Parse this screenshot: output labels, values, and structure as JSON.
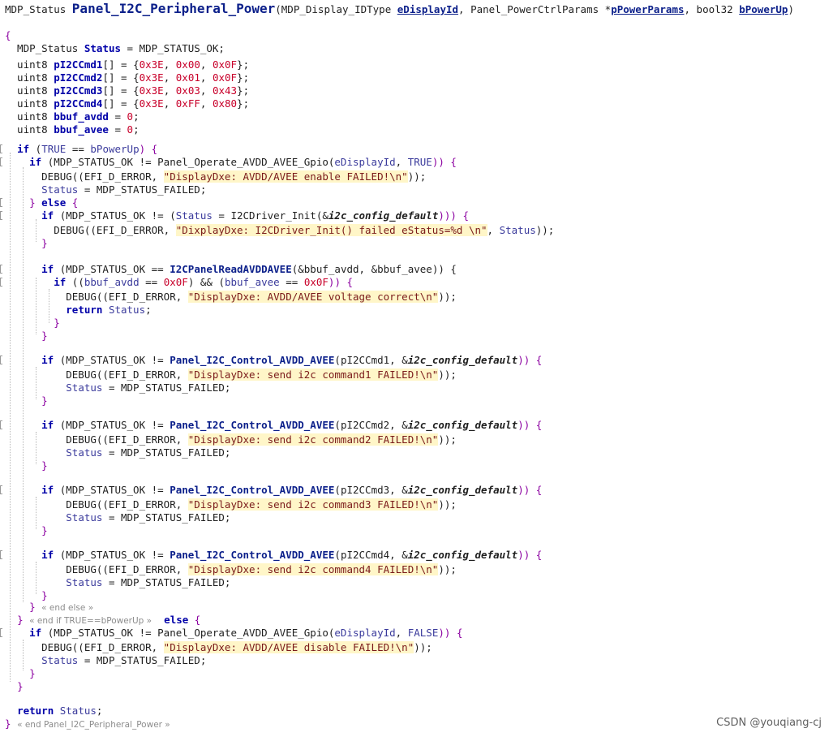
{
  "window": {
    "title": "Panel_I2C_Peripheral_Power"
  },
  "watermark": "CSDN @youqiang-cj",
  "lines": [
    {
      "t": [
        [
          "MDP_Status ",
          "typ"
        ],
        [
          "Panel_I2C_Peripheral_Power",
          "fnbig"
        ],
        [
          "(MDP_Display_IDType ",
          "typ"
        ],
        [
          "eDisplayId",
          "prm"
        ],
        [
          ", Panel_PowerCtrlParams *",
          "typ"
        ],
        [
          "pPowerParams",
          "prm"
        ],
        [
          ", bool32 ",
          "typ"
        ],
        [
          "bPowerUp",
          "prm"
        ],
        [
          ")",
          "typ"
        ]
      ]
    },
    {
      "t": [
        [
          "{",
          "brc"
        ]
      ]
    },
    {
      "t": [
        [
          "  MDP_Status ",
          "typ"
        ],
        [
          "Status",
          "kw"
        ],
        [
          " = MDP_STATUS_OK;",
          "cst"
        ]
      ]
    },
    {
      "t": []
    },
    {
      "t": [
        [
          "  uint8 ",
          "typ"
        ],
        [
          "pI2CCmd1",
          "kw"
        ],
        [
          "[] = {",
          "typ"
        ],
        [
          "0x3E",
          "num"
        ],
        [
          ", ",
          "typ"
        ],
        [
          "0x00",
          "num"
        ],
        [
          ", ",
          "typ"
        ],
        [
          "0x0F",
          "num"
        ],
        [
          "};",
          "typ"
        ]
      ]
    },
    {
      "t": [
        [
          "  uint8 ",
          "typ"
        ],
        [
          "pI2CCmd2",
          "kw"
        ],
        [
          "[] = {",
          "typ"
        ],
        [
          "0x3E",
          "num"
        ],
        [
          ", ",
          "typ"
        ],
        [
          "0x01",
          "num"
        ],
        [
          ", ",
          "typ"
        ],
        [
          "0x0F",
          "num"
        ],
        [
          "};",
          "typ"
        ]
      ]
    },
    {
      "t": [
        [
          "  uint8 ",
          "typ"
        ],
        [
          "pI2CCmd3",
          "kw"
        ],
        [
          "[] = {",
          "typ"
        ],
        [
          "0x3E",
          "num"
        ],
        [
          ", ",
          "typ"
        ],
        [
          "0x03",
          "num"
        ],
        [
          ", ",
          "typ"
        ],
        [
          "0x43",
          "num"
        ],
        [
          "};",
          "typ"
        ]
      ]
    },
    {
      "t": [
        [
          "  uint8 ",
          "typ"
        ],
        [
          "pI2CCmd4",
          "kw"
        ],
        [
          "[] = {",
          "typ"
        ],
        [
          "0x3E",
          "num"
        ],
        [
          ", ",
          "typ"
        ],
        [
          "0xFF",
          "num"
        ],
        [
          ", ",
          "typ"
        ],
        [
          "0x80",
          "num"
        ],
        [
          "};",
          "typ"
        ]
      ]
    },
    {
      "t": [
        [
          "  uint8 ",
          "typ"
        ],
        [
          "bbuf_avdd",
          "kw"
        ],
        [
          " = ",
          "typ"
        ],
        [
          "0",
          "num"
        ],
        [
          ";",
          "typ"
        ]
      ]
    },
    {
      "t": [
        [
          "  uint8 ",
          "typ"
        ],
        [
          "bbuf_avee",
          "kw"
        ],
        [
          " = ",
          "typ"
        ],
        [
          "0",
          "num"
        ],
        [
          ";",
          "typ"
        ]
      ]
    },
    {
      "t": []
    },
    {
      "m": 1,
      "t": [
        [
          "  ",
          "typ"
        ],
        [
          "if",
          "kw"
        ],
        [
          " (",
          "typ"
        ],
        [
          "TRUE",
          "var"
        ],
        [
          " == ",
          "typ"
        ],
        [
          "bPowerUp",
          "var"
        ],
        [
          ") {",
          "brc"
        ]
      ]
    },
    {
      "m": 1,
      "t": [
        [
          "    ",
          "typ"
        ],
        [
          "if",
          "kw"
        ],
        [
          " (MDP_STATUS_OK != Panel_Operate_AVDD_AVEE_Gpio(",
          "typ"
        ],
        [
          "eDisplayId",
          "var"
        ],
        [
          ", ",
          "typ"
        ],
        [
          "TRUE",
          "var"
        ],
        [
          ")) {",
          "brc"
        ]
      ]
    },
    {
      "t": [
        [
          "      DEBUG((EFI_D_ERROR, ",
          "typ"
        ],
        [
          "\"DisplayDxe: AVDD/AVEE enable FAILED!\\n\"",
          "str"
        ],
        [
          "));",
          "typ"
        ]
      ]
    },
    {
      "t": [
        [
          "      ",
          "typ"
        ],
        [
          "Status",
          "var"
        ],
        [
          " = MDP_STATUS_FAILED;",
          "cst"
        ]
      ]
    },
    {
      "m": 1,
      "t": [
        [
          "    ",
          "typ"
        ],
        [
          "}",
          "brc"
        ],
        [
          " ",
          "typ"
        ],
        [
          "else",
          "kw"
        ],
        [
          " {",
          "brc"
        ]
      ]
    },
    {
      "m": 1,
      "t": [
        [
          "      ",
          "typ"
        ],
        [
          "if",
          "kw"
        ],
        [
          " (MDP_STATUS_OK != (",
          "typ"
        ],
        [
          "Status",
          "var"
        ],
        [
          " = I2CDriver_Init(&",
          "typ"
        ],
        [
          "i2c_config_default",
          "ital"
        ],
        [
          "))) {",
          "brc"
        ]
      ]
    },
    {
      "t": [
        [
          "        DEBUG((EFI_D_ERROR, ",
          "typ"
        ],
        [
          "\"DixplayDxe: I2CDriver_Init() failed eStatus=%d \\n\"",
          "str"
        ],
        [
          ", ",
          "typ"
        ],
        [
          "Status",
          "var"
        ],
        [
          "));",
          "typ"
        ]
      ]
    },
    {
      "t": [
        [
          "      ",
          "typ"
        ],
        [
          "}",
          "brc"
        ]
      ]
    },
    {
      "t": []
    },
    {
      "m": 1,
      "t": [
        [
          "      ",
          "typ"
        ],
        [
          "if",
          "kw"
        ],
        [
          " (MDP_STATUS_OK == ",
          "typ"
        ],
        [
          "I2CPanelReadAVDDAVEE",
          "fnb"
        ],
        [
          "(&bbuf_avdd, &bbuf_avee)) {",
          "typ"
        ]
      ]
    },
    {
      "m": 1,
      "t": [
        [
          "        ",
          "typ"
        ],
        [
          "if",
          "kw"
        ],
        [
          " ((",
          "typ"
        ],
        [
          "bbuf_avdd",
          "var"
        ],
        [
          " == ",
          "typ"
        ],
        [
          "0x0F",
          "num"
        ],
        [
          ") && (",
          "typ"
        ],
        [
          "bbuf_avee",
          "var"
        ],
        [
          " == ",
          "typ"
        ],
        [
          "0x0F",
          "num"
        ],
        [
          ")) {",
          "brc"
        ]
      ]
    },
    {
      "t": [
        [
          "          DEBUG((EFI_D_ERROR, ",
          "typ"
        ],
        [
          "\"DisplayDxe: AVDD/AVEE voltage correct\\n\"",
          "str"
        ],
        [
          "));",
          "typ"
        ]
      ]
    },
    {
      "t": [
        [
          "          ",
          "typ"
        ],
        [
          "return",
          "kw"
        ],
        [
          " ",
          "typ"
        ],
        [
          "Status",
          "var"
        ],
        [
          ";",
          "typ"
        ]
      ]
    },
    {
      "t": [
        [
          "        ",
          "typ"
        ],
        [
          "}",
          "brc"
        ]
      ]
    },
    {
      "t": [
        [
          "      ",
          "typ"
        ],
        [
          "}",
          "brc"
        ]
      ]
    },
    {
      "t": []
    },
    {
      "m": 1,
      "t": [
        [
          "      ",
          "typ"
        ],
        [
          "if",
          "kw"
        ],
        [
          " (MDP_STATUS_OK != ",
          "typ"
        ],
        [
          "Panel_I2C_Control_AVDD_AVEE",
          "fnb"
        ],
        [
          "(pI2CCmd1, &",
          "typ"
        ],
        [
          "i2c_config_default",
          "ital"
        ],
        [
          ")) {",
          "brc"
        ]
      ]
    },
    {
      "t": [
        [
          "          DEBUG((EFI_D_ERROR, ",
          "typ"
        ],
        [
          "\"DisplayDxe: send i2c command1 FAILED!\\n\"",
          "str"
        ],
        [
          "));",
          "typ"
        ]
      ]
    },
    {
      "t": [
        [
          "          ",
          "typ"
        ],
        [
          "Status",
          "var"
        ],
        [
          " = MDP_STATUS_FAILED;",
          "cst"
        ]
      ]
    },
    {
      "t": [
        [
          "      ",
          "typ"
        ],
        [
          "}",
          "brc"
        ]
      ]
    },
    {
      "t": []
    },
    {
      "m": 1,
      "t": [
        [
          "      ",
          "typ"
        ],
        [
          "if",
          "kw"
        ],
        [
          " (MDP_STATUS_OK != ",
          "typ"
        ],
        [
          "Panel_I2C_Control_AVDD_AVEE",
          "fnb"
        ],
        [
          "(pI2CCmd2, &",
          "typ"
        ],
        [
          "i2c_config_default",
          "ital"
        ],
        [
          ")) {",
          "brc"
        ]
      ]
    },
    {
      "t": [
        [
          "          DEBUG((EFI_D_ERROR, ",
          "typ"
        ],
        [
          "\"DisplayDxe: send i2c command2 FAILED!\\n\"",
          "str"
        ],
        [
          "));",
          "typ"
        ]
      ]
    },
    {
      "t": [
        [
          "          ",
          "typ"
        ],
        [
          "Status",
          "var"
        ],
        [
          " = MDP_STATUS_FAILED;",
          "cst"
        ]
      ]
    },
    {
      "t": [
        [
          "      ",
          "typ"
        ],
        [
          "}",
          "brc"
        ]
      ]
    },
    {
      "t": []
    },
    {
      "m": 1,
      "t": [
        [
          "      ",
          "typ"
        ],
        [
          "if",
          "kw"
        ],
        [
          " (MDP_STATUS_OK != ",
          "typ"
        ],
        [
          "Panel_I2C_Control_AVDD_AVEE",
          "fnb"
        ],
        [
          "(pI2CCmd3, &",
          "typ"
        ],
        [
          "i2c_config_default",
          "ital"
        ],
        [
          ")) {",
          "brc"
        ]
      ]
    },
    {
      "t": [
        [
          "          DEBUG((EFI_D_ERROR, ",
          "typ"
        ],
        [
          "\"DisplayDxe: send i2c command3 FAILED!\\n\"",
          "str"
        ],
        [
          "));",
          "typ"
        ]
      ]
    },
    {
      "t": [
        [
          "          ",
          "typ"
        ],
        [
          "Status",
          "var"
        ],
        [
          " = MDP_STATUS_FAILED;",
          "cst"
        ]
      ]
    },
    {
      "t": [
        [
          "      ",
          "typ"
        ],
        [
          "}",
          "brc"
        ]
      ]
    },
    {
      "t": []
    },
    {
      "m": 1,
      "t": [
        [
          "      ",
          "typ"
        ],
        [
          "if",
          "kw"
        ],
        [
          " (MDP_STATUS_OK != ",
          "typ"
        ],
        [
          "Panel_I2C_Control_AVDD_AVEE",
          "fnb"
        ],
        [
          "(pI2CCmd4, &",
          "typ"
        ],
        [
          "i2c_config_default",
          "ital"
        ],
        [
          ")) {",
          "brc"
        ]
      ]
    },
    {
      "t": [
        [
          "          DEBUG((EFI_D_ERROR, ",
          "typ"
        ],
        [
          "\"DisplayDxe: send i2c command4 FAILED!\\n\"",
          "str"
        ],
        [
          "));",
          "typ"
        ]
      ]
    },
    {
      "t": [
        [
          "          ",
          "typ"
        ],
        [
          "Status",
          "var"
        ],
        [
          " = MDP_STATUS_FAILED;",
          "cst"
        ]
      ]
    },
    {
      "t": [
        [
          "      ",
          "typ"
        ],
        [
          "}",
          "brc"
        ]
      ]
    },
    {
      "t": [
        [
          "    ",
          "typ"
        ],
        [
          "}",
          "brc"
        ],
        [
          " ",
          "typ"
        ],
        [
          "« end else »",
          "cmt"
        ]
      ]
    },
    {
      "t": [
        [
          "  ",
          "typ"
        ],
        [
          "}",
          "brc"
        ],
        [
          " ",
          "typ"
        ],
        [
          "« end if TRUE==bPowerUp »",
          "cmt"
        ],
        [
          "  ",
          "typ"
        ],
        [
          "else",
          "kw"
        ],
        [
          " {",
          "brc"
        ]
      ]
    },
    {
      "m": 1,
      "t": [
        [
          "    ",
          "typ"
        ],
        [
          "if",
          "kw"
        ],
        [
          " (MDP_STATUS_OK != Panel_Operate_AVDD_AVEE_Gpio(",
          "typ"
        ],
        [
          "eDisplayId",
          "var"
        ],
        [
          ", ",
          "typ"
        ],
        [
          "FALSE",
          "var"
        ],
        [
          ")) {",
          "brc"
        ]
      ]
    },
    {
      "t": [
        [
          "      DEBUG((EFI_D_ERROR, ",
          "typ"
        ],
        [
          "\"DisplayDxe: AVDD/AVEE disable FAILED!\\n\"",
          "str"
        ],
        [
          "));",
          "typ"
        ]
      ]
    },
    {
      "t": [
        [
          "      ",
          "typ"
        ],
        [
          "Status",
          "var"
        ],
        [
          " = MDP_STATUS_FAILED;",
          "cst"
        ]
      ]
    },
    {
      "t": [
        [
          "    ",
          "typ"
        ],
        [
          "}",
          "brc"
        ]
      ]
    },
    {
      "t": [
        [
          "  ",
          "typ"
        ],
        [
          "}",
          "brc"
        ]
      ]
    },
    {
      "t": []
    },
    {
      "t": [
        [
          "  ",
          "typ"
        ],
        [
          "return",
          "kw"
        ],
        [
          " ",
          "typ"
        ],
        [
          "Status",
          "var"
        ],
        [
          ";",
          "typ"
        ]
      ]
    },
    {
      "t": [
        [
          "}",
          "brc"
        ],
        [
          " ",
          "typ"
        ],
        [
          "« end Panel_I2C_Peripheral_Power »",
          "cmt"
        ]
      ]
    }
  ]
}
